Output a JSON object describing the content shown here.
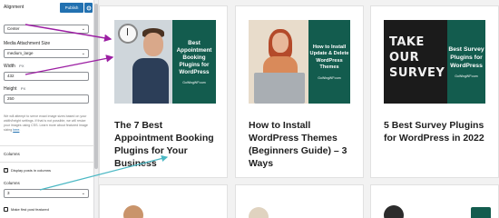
{
  "sidebar": {
    "publish_label": "Publish",
    "alignment": {
      "label": "Alignment",
      "value": "Center"
    },
    "media_size": {
      "label": "Media Attachment Size",
      "value": "medium_large"
    },
    "width": {
      "label": "Width",
      "unit": "PX",
      "value": "432"
    },
    "height": {
      "label": "Height",
      "unit": "PX",
      "value": "250"
    },
    "help_text_before_link": "We will attempt to serve exact image sizes based on your width/height settings. If that is not possible, we will resize your images using CSS. Learn more about featured image sizing",
    "help_link": "here",
    "help_text_after_link": ".",
    "columns_section": "Columns",
    "display_posts_in_columns": {
      "label": "Display posts in columns",
      "checked": true
    },
    "columns": {
      "label": "Columns",
      "value": "3"
    },
    "make_first_post_featured": {
      "label": "Make first post featured",
      "checked": false
    }
  },
  "cards": [
    {
      "title": "The 7 Best Appointment Booking Plugins for Your Business",
      "panel_text": "Best Appointment Booking Plugins for WordPress",
      "panel_brand": "GoWingWP.com",
      "panel_color": "#135c4e"
    },
    {
      "title": "How to Install WordPress Themes (Beginners Guide) – 3 Ways",
      "panel_text": "How to Install Update & Delete WordPress Themes",
      "panel_brand": "GoWingWP.com",
      "panel_color": "#135c4e"
    },
    {
      "title": "5 Best Survey Plugins for WordPress in 2022",
      "panel_text": "Best Survey Plugins for WordPress",
      "panel_brand": "GoWingWP.com",
      "panel_color": "#135c4e",
      "image_text": "TAKE OUR SURVEY"
    }
  ],
  "colors": {
    "accent": "#2271b1",
    "arrow": "#9c1fa3",
    "arrow_teal": "#4bb8c4"
  }
}
